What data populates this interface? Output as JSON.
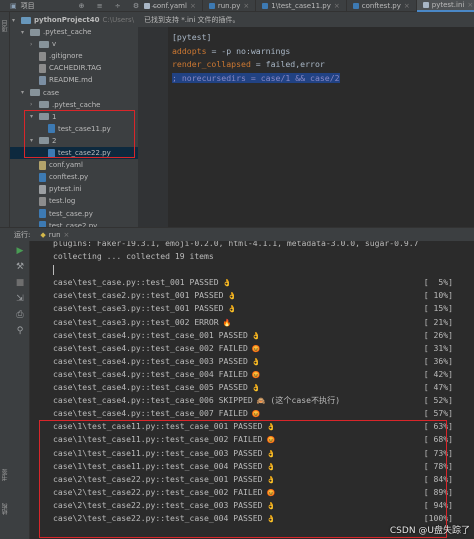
{
  "top": {
    "project_tab": "项目",
    "editor_tabs": [
      {
        "label": "conf.yaml",
        "kind": "yaml",
        "active": false
      },
      {
        "label": "run.py",
        "kind": "py",
        "active": false
      },
      {
        "label": "1\\test_case11.py",
        "kind": "py",
        "active": false
      },
      {
        "label": "conftest.py",
        "kind": "py",
        "active": false
      },
      {
        "label": "pytest.ini",
        "kind": "ini",
        "active": true
      }
    ]
  },
  "left_stripe": {
    "project_label": "项目"
  },
  "tree": {
    "root_label": "pythonProject40",
    "root_path": "C:\\Users\\",
    "items": [
      {
        "label": ".pytest_cache",
        "type": "folder",
        "depth": 1,
        "arrow": "▾"
      },
      {
        "label": "v",
        "type": "folder",
        "depth": 2,
        "arrow": "›"
      },
      {
        "label": ".gitignore",
        "type": "file",
        "kind": "log",
        "depth": 2
      },
      {
        "label": "CACHEDIR.TAG",
        "type": "file",
        "kind": "log",
        "depth": 2
      },
      {
        "label": "README.md",
        "type": "file",
        "kind": "md",
        "depth": 2
      },
      {
        "label": "case",
        "type": "folder",
        "depth": 1,
        "arrow": "▾"
      },
      {
        "label": ".pytest_cache",
        "type": "folder",
        "depth": 2,
        "arrow": "›"
      },
      {
        "label": "1",
        "type": "folder",
        "depth": 2,
        "arrow": "▾"
      },
      {
        "label": "test_case11.py",
        "type": "file",
        "kind": "py",
        "depth": 3
      },
      {
        "label": "2",
        "type": "folder",
        "depth": 2,
        "arrow": "▾"
      },
      {
        "label": "test_case22.py",
        "type": "file",
        "kind": "py",
        "depth": 3,
        "selected": true
      },
      {
        "label": "conf.yaml",
        "type": "file",
        "kind": "yaml",
        "depth": 2
      },
      {
        "label": "conftest.py",
        "type": "file",
        "kind": "py",
        "depth": 2
      },
      {
        "label": "pytest.ini",
        "type": "file",
        "kind": "ini",
        "depth": 2
      },
      {
        "label": "test.log",
        "type": "file",
        "kind": "log",
        "depth": 2
      },
      {
        "label": "test_case.py",
        "type": "file",
        "kind": "py",
        "depth": 2
      },
      {
        "label": "test_case2.py",
        "type": "file",
        "kind": "py",
        "depth": 2
      }
    ]
  },
  "editor": {
    "notice": "已找到支持 *.ini 文件的插件。",
    "lines": [
      {
        "key": "[pytest]",
        "value": "",
        "style": "v"
      },
      {
        "key": "addopts",
        "value": " = -p no:warnings",
        "style": "k"
      },
      {
        "key": "render_collapsed",
        "value": " = failed,error",
        "style": "k"
      },
      {
        "key": "; norecursedirs = case/1 && case/2",
        "value": "",
        "style": "sel"
      }
    ]
  },
  "run": {
    "header_label": "运行:",
    "tab_label": "run",
    "stripe_labels": {
      "bookmarks": "书签",
      "structure": "结构"
    }
  },
  "console": {
    "lines": [
      {
        "text": "plugins: Faker-19.3.1, emoji-0.2.0, html-4.1.1, metadata-3.0.0, sugar-0.9.7",
        "emoji": "",
        "pct": ""
      },
      {
        "text": "collecting ... collected 19 items",
        "emoji": "",
        "pct": ""
      },
      {
        "text": "",
        "emoji": "",
        "pct": "",
        "cursor": true
      },
      {
        "text": "case\\test_case.py::test_001 PASSED",
        "emoji": "ok",
        "pct": "[  5%]"
      },
      {
        "text": "case\\test_case2.py::test_001 PASSED",
        "emoji": "ok",
        "pct": "[ 10%]"
      },
      {
        "text": "case\\test_case3.py::test_001 PASSED",
        "emoji": "ok",
        "pct": "[ 15%]"
      },
      {
        "text": "case\\test_case3.py::test_002 ERROR",
        "emoji": "err",
        "pct": "[ 21%]"
      },
      {
        "text": "case\\test_case4.py::test_case_001 PASSED",
        "emoji": "ok",
        "pct": "[ 26%]"
      },
      {
        "text": "case\\test_case4.py::test_case_002 FAILED",
        "emoji": "bad",
        "pct": "[ 31%]"
      },
      {
        "text": "case\\test_case4.py::test_case_003 PASSED",
        "emoji": "ok",
        "pct": "[ 36%]"
      },
      {
        "text": "case\\test_case4.py::test_case_004 FAILED",
        "emoji": "bad",
        "pct": "[ 42%]"
      },
      {
        "text": "case\\test_case4.py::test_case_005 PASSED",
        "emoji": "ok",
        "pct": "[ 47%]"
      },
      {
        "text": "case\\test_case4.py::test_case_006 SKIPPED",
        "emoji": "skip",
        "pct": "[ 52%]",
        "note": " (这个case不执行)"
      },
      {
        "text": "case\\test_case4.py::test_case_007 FAILED",
        "emoji": "bad",
        "pct": "[ 57%]"
      },
      {
        "text": "case\\1\\test_case11.py::test_case_001 PASSED",
        "emoji": "ok",
        "pct": "[ 63%]"
      },
      {
        "text": "case\\1\\test_case11.py::test_case_002 FAILED",
        "emoji": "bad",
        "pct": "[ 68%]"
      },
      {
        "text": "case\\1\\test_case11.py::test_case_003 PASSED",
        "emoji": "ok",
        "pct": "[ 73%]"
      },
      {
        "text": "case\\1\\test_case11.py::test_case_004 PASSED",
        "emoji": "ok",
        "pct": "[ 78%]"
      },
      {
        "text": "case\\2\\test_case22.py::test_case_001 PASSED",
        "emoji": "ok",
        "pct": "[ 84%]"
      },
      {
        "text": "case\\2\\test_case22.py::test_case_002 FAILED",
        "emoji": "bad",
        "pct": "[ 89%]"
      },
      {
        "text": "case\\2\\test_case22.py::test_case_003 PASSED",
        "emoji": "ok",
        "pct": "[ 94%]"
      },
      {
        "text": "case\\2\\test_case22.py::test_case_004 PASSED",
        "emoji": "ok",
        "pct": "[100%]"
      }
    ],
    "emoji_glyphs": {
      "ok": "👌",
      "bad": "😡",
      "err": "🔥",
      "skip": "🙈"
    }
  },
  "watermark": "CSDN @U盘失踪了",
  "colors": {
    "highlight_box": "#d9262a",
    "selection": "#0d293e",
    "accent": "#4a88c7"
  }
}
